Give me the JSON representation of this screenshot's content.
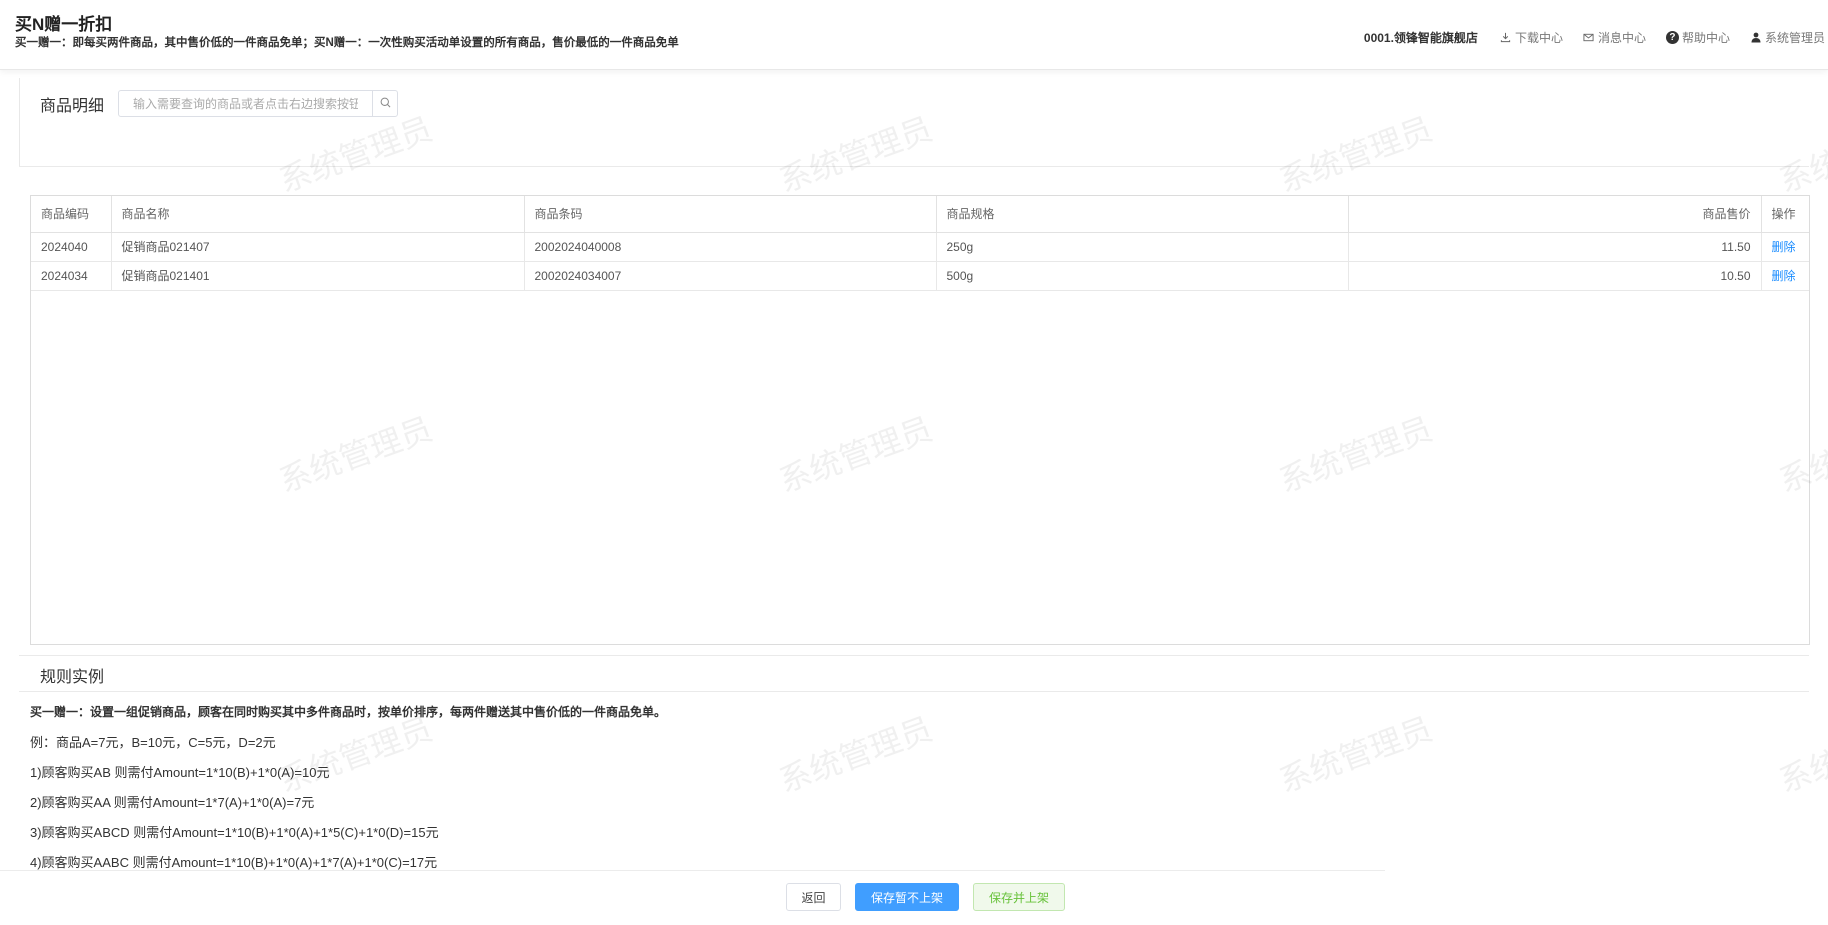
{
  "header": {
    "title": "买N赠一折扣",
    "description": "买一赠一：即每买两件商品，其中售价低的一件商品免单；买N赠一：一次性购买活动单设置的所有商品，售价最低的一件商品免单",
    "store": "0001.领锋智能旗舰店",
    "links": {
      "download": "下载中心",
      "messages": "消息中心",
      "help": "帮助中心",
      "user": "系统管理员"
    }
  },
  "product_section": {
    "title": "商品明细",
    "search_placeholder": "输入需要查询的商品或者点击右边搜索按钮"
  },
  "table": {
    "headers": [
      "商品编码",
      "商品名称",
      "商品条码",
      "商品规格",
      "商品售价",
      "操作"
    ],
    "rows": [
      {
        "code": "2024040",
        "name": "促销商品021407",
        "barcode": "2002024040008",
        "spec": "250g",
        "price": "11.50",
        "action": "删除"
      },
      {
        "code": "2024034",
        "name": "促销商品021401",
        "barcode": "2002024034007",
        "spec": "500g",
        "price": "10.50",
        "action": "删除"
      }
    ]
  },
  "rules": {
    "title": "规则实例",
    "summary": "买一赠一：设置一组促销商品，顾客在同时购买其中多件商品时，按单价排序，每两件赠送其中售价低的一件商品免单。",
    "example": "例：商品A=7元，B=10元，C=5元，D=2元",
    "cases": [
      "1)顾客购买AB 则需付Amount=1*10(B)+1*0(A)=10元",
      "2)顾客购买AA 则需付Amount=1*7(A)+1*0(A)=7元",
      "3)顾客购买ABCD 则需付Amount=1*10(B)+1*0(A)+1*5(C)+1*0(D)=15元",
      "4)顾客购买AABC 则需付Amount=1*10(B)+1*0(A)+1*7(A)+1*0(C)=17元"
    ]
  },
  "watermark": "系统管理员",
  "footer": {
    "back": "返回",
    "save_draft": "保存暂不上架",
    "save_publish": "保存并上架"
  },
  "colors": {
    "primary": "#409eff",
    "link": "#1a8cff",
    "success_text": "#67c23a",
    "success_bg": "#f0f9eb"
  },
  "icons": {
    "download": "download-icon",
    "messages": "envelope-icon",
    "help": "question-circle-icon",
    "user": "user-icon",
    "search": "search-icon"
  }
}
